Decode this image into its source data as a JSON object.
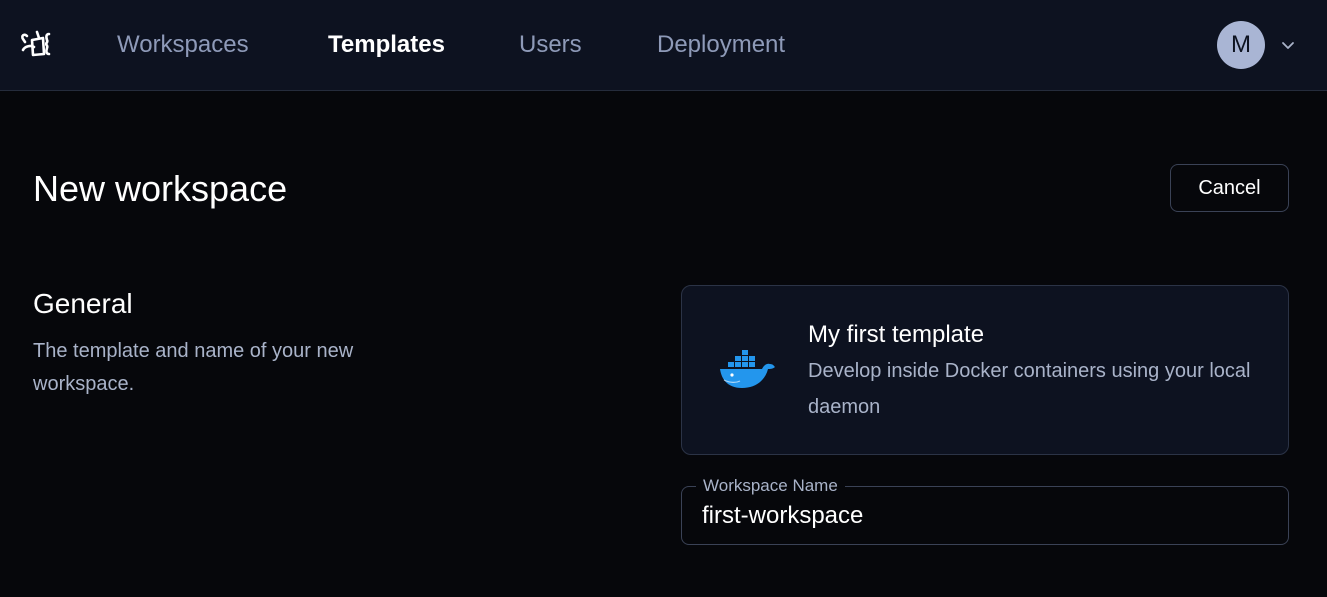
{
  "nav": {
    "items": [
      {
        "label": "Workspaces",
        "active": false
      },
      {
        "label": "Templates",
        "active": true
      },
      {
        "label": "Users",
        "active": false
      },
      {
        "label": "Deployment",
        "active": false
      }
    ],
    "avatar_initial": "M",
    "logo_icon": "coder-logo-icon",
    "menu_icon": "chevron-down-icon"
  },
  "page": {
    "title": "New workspace",
    "cancel_label": "Cancel"
  },
  "general": {
    "title": "General",
    "description": "The template and name of your new workspace."
  },
  "template": {
    "name": "My first template",
    "description": "Develop inside Docker containers using your local daemon",
    "icon": "docker-icon"
  },
  "workspace_name_field": {
    "label": "Workspace Name",
    "value": "first-workspace"
  },
  "colors": {
    "background": "#06070b",
    "topbar": "#0d1220",
    "avatar": "#a9b5d4",
    "docker_blue": "#2396ed"
  }
}
